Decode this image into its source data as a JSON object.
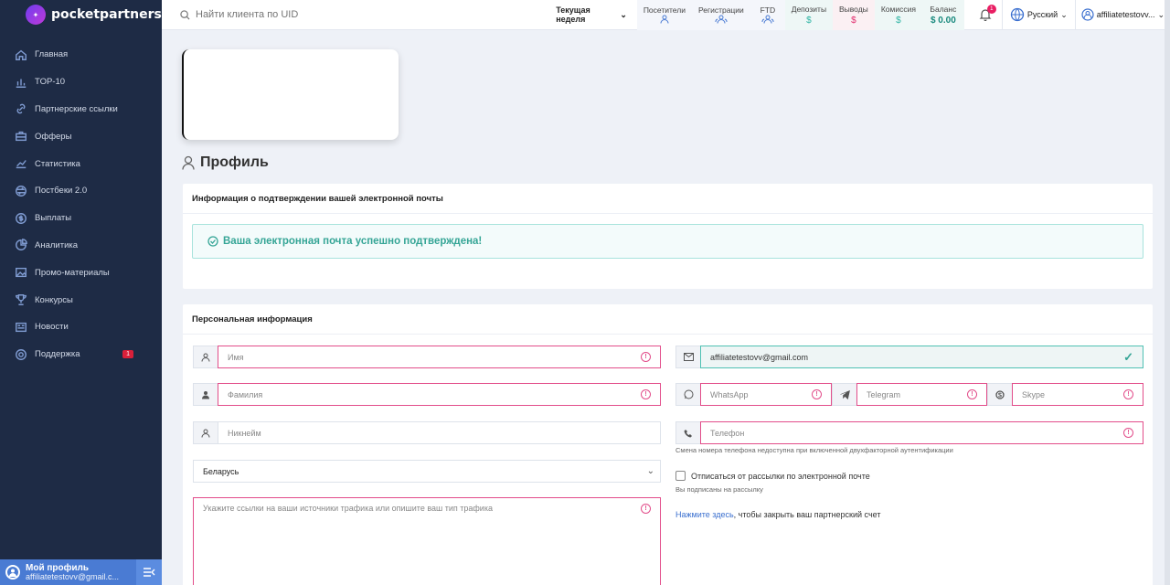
{
  "brand": {
    "name": "pocketpartners"
  },
  "sidebar": {
    "items": [
      {
        "label": "Главная",
        "icon": "home-icon"
      },
      {
        "label": "TOP-10",
        "icon": "bar-chart-icon"
      },
      {
        "label": "Партнерские ссылки",
        "icon": "link-icon"
      },
      {
        "label": "Офферы",
        "icon": "briefcase-icon"
      },
      {
        "label": "Статистика",
        "icon": "trend-icon"
      },
      {
        "label": "Постбеки 2.0",
        "icon": "postback-icon"
      },
      {
        "label": "Выплаты",
        "icon": "dollar-icon"
      },
      {
        "label": "Аналитика",
        "icon": "pie-icon"
      },
      {
        "label": "Промо-материалы",
        "icon": "image-icon"
      },
      {
        "label": "Конкурсы",
        "icon": "trophy-icon"
      },
      {
        "label": "Новости",
        "icon": "news-icon"
      },
      {
        "label": "Поддержка",
        "icon": "support-icon",
        "badge": "1"
      }
    ],
    "profile": {
      "title": "Мой профиль",
      "email": "affiliatetestovv@gmail.c..."
    }
  },
  "topbar": {
    "search_placeholder": "Найти клиента по UID",
    "period": "Текущая неделя",
    "stats": [
      {
        "label": "Посетители",
        "value": "",
        "color": "#4a7bd3",
        "bg": "#f4f6fb"
      },
      {
        "label": "Регистрации",
        "value": "",
        "color": "#4a7bd3",
        "bg": "#f4f6fb"
      },
      {
        "label": "FTD",
        "value": "",
        "color": "#4a7bd3",
        "bg": "#f4f6fb"
      },
      {
        "label": "Депозиты",
        "value": "$",
        "color": "#2bb3a2",
        "bg": "#eef7f6"
      },
      {
        "label": "Выводы",
        "value": "$",
        "color": "#e0286a",
        "bg": "#fbf0f3"
      },
      {
        "label": "Комиссия",
        "value": "$",
        "color": "#2bb3a2",
        "bg": "#eef7f6"
      },
      {
        "label": "Баланс",
        "value": "$ 0.00",
        "color": "#1a8a7e",
        "bg": "#eef7f6"
      }
    ],
    "notifications": "1",
    "language": "Русский",
    "user": "affiliatetestovv..."
  },
  "page": {
    "title": "Профиль"
  },
  "email_card": {
    "title": "Информация о подтверждении вашей электронной почты",
    "message": "Ваша электронная почта успешно подтверждена!"
  },
  "personal": {
    "title": "Персональная информация",
    "first_name_ph": "Имя",
    "last_name_ph": "Фамилия",
    "nickname_ph": "Никнейм",
    "country": "Беларусь",
    "traffic_ph": "Укажите ссылки на ваши источники трафика или опишите ваш тип трафика",
    "email": "affiliatetestovv@gmail.com",
    "whatsapp_ph": "WhatsApp",
    "telegram_ph": "Telegram",
    "skype_ph": "Skype",
    "phone_ph": "Телефон",
    "phone_hint": "Смена номера телефона недоступна при включенной двухфакторной аутентификации",
    "unsubscribe_label": "Отписаться от рассылки по электронной почте",
    "subscribed_hint": "Вы подписаны на рассылку",
    "close_link": "Нажмите здесь",
    "close_text": ", чтобы закрыть ваш партнерский счет"
  }
}
